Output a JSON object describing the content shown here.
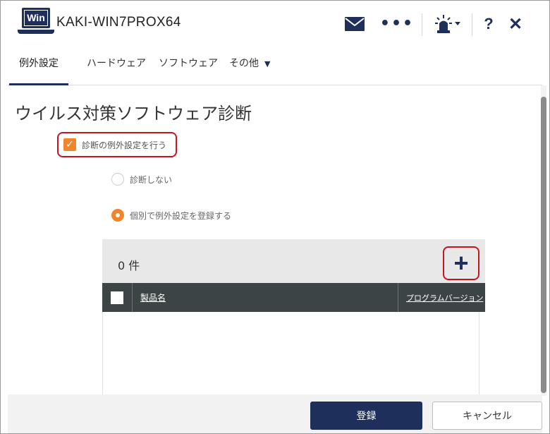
{
  "header": {
    "logo_text": "Win",
    "hostname": "KAKI-WIN7PROX64",
    "more_label": "•••",
    "help_label": "?",
    "close_label": "✕"
  },
  "tabs": [
    {
      "label": "例外設定",
      "active": true
    },
    {
      "label": "ハードウェア",
      "active": false
    },
    {
      "label": "ソフトウェア",
      "active": false
    },
    {
      "label": "その他",
      "active": false,
      "has_dropdown": true
    }
  ],
  "main": {
    "title": "ウイルス対策ソフトウェア診断",
    "exception_checkbox": {
      "label": "診断の例外設定を行う",
      "checked": true
    },
    "radios": [
      {
        "label": "診断しない",
        "selected": false
      },
      {
        "label": "個別で例外設定を登録する",
        "selected": true
      }
    ]
  },
  "list": {
    "count_label": "0 件",
    "add_label": "+",
    "columns": [
      "製品名",
      "プログラムバージョン"
    ],
    "rows": []
  },
  "footer": {
    "register_label": "登録",
    "cancel_label": "キャンセル"
  },
  "colors": {
    "brand_navy": "#1e2f5c",
    "accent_orange": "#f0852b",
    "highlight_red": "#c8141e",
    "table_header": "#3d4446"
  },
  "icons": {
    "logo": "win-pc-icon",
    "mail": "mail-icon",
    "more": "more-dots-icon",
    "alert": "siren-alert-icon",
    "help": "help-icon",
    "close": "close-icon",
    "add": "plus-icon"
  }
}
